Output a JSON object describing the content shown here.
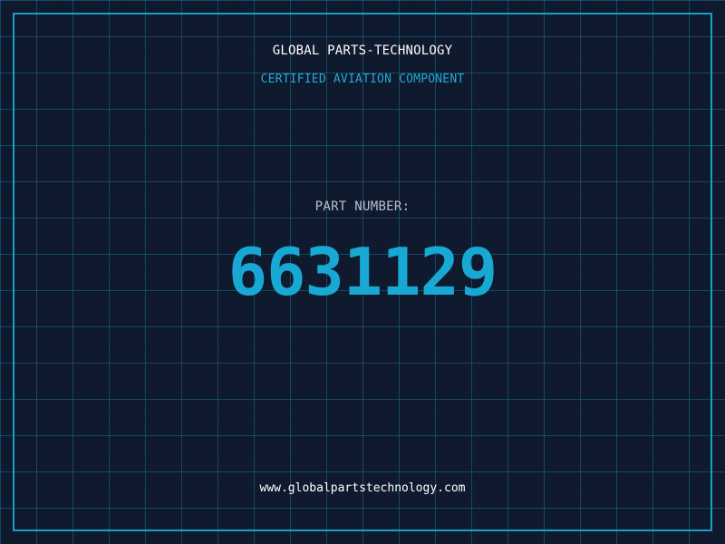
{
  "header": {
    "company": "GLOBAL PARTS-TECHNOLOGY",
    "subtitle": "CERTIFIED AVIATION COMPONENT"
  },
  "part": {
    "label": "PART NUMBER:",
    "number": "6631129"
  },
  "footer": {
    "website": "www.globalpartstechnology.com"
  },
  "colors": {
    "background": "#101a2e",
    "grid": "#1682a0",
    "accent": "#1a9fc4",
    "text": "#ffffff",
    "label": "#b9c0cc"
  }
}
